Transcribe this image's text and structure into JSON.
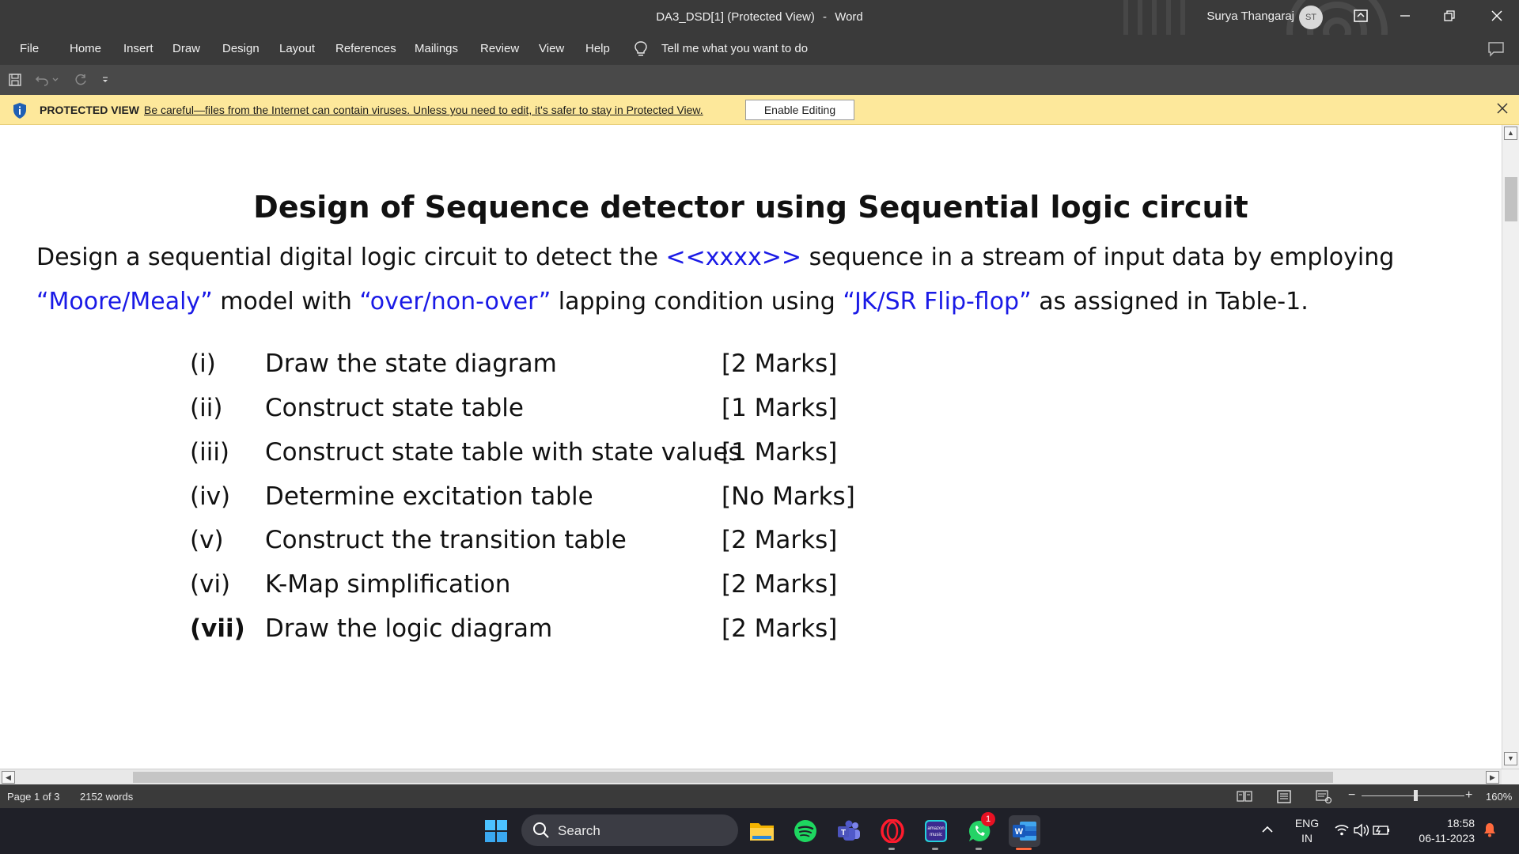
{
  "window": {
    "doc_title": "DA3_DSD[1] (Protected View)",
    "app_name": "Word",
    "title_separator": "-",
    "user_name": "Surya Thangaraj",
    "user_initials": "ST"
  },
  "menu": {
    "tabs": [
      "File",
      "Home",
      "Insert",
      "Draw",
      "Design",
      "Layout",
      "References",
      "Mailings",
      "Review",
      "View",
      "Help"
    ],
    "tell_me": "Tell me what you want to do"
  },
  "protected_view": {
    "label": "PROTECTED VIEW",
    "message": "Be careful—files from the Internet can contain viruses. Unless you need to edit, it's safer to stay in Protected View.",
    "enable_button": "Enable Editing"
  },
  "document": {
    "heading": "Design of Sequence detector using Sequential logic circuit",
    "para": {
      "p1": "Design a sequential digital logic circuit to detect the ",
      "seq": "<<xxxx>>",
      "p2": " sequence in a stream of input data by employing ",
      "model": "“Moore/Mealy”",
      "p3": " model with ",
      "overlap": "“over/non-over”",
      "p4": " lapping condition using ",
      "flipflop": "“JK/SR Flip-flop”",
      "p5": " as assigned in Table-1."
    },
    "tasks": [
      {
        "num": "(i)",
        "desc": "Draw the state diagram",
        "marks": "[2 Marks]"
      },
      {
        "num": "(ii)",
        "desc": "Construct state table",
        "marks": "[1 Marks]"
      },
      {
        "num": "(iii)",
        "desc": "Construct state table with state values",
        "marks": "[1 Marks]"
      },
      {
        "num": "(iv)",
        "desc": "Determine excitation table",
        "marks": "[No Marks]"
      },
      {
        "num": "(v)",
        "desc": "Construct the transition table",
        "marks": "[2 Marks]"
      },
      {
        "num": "(vi)",
        "desc": "K-Map simplification",
        "marks": "[2 Marks]"
      },
      {
        "num": "(vii)",
        "desc": "Draw the logic diagram",
        "marks": "[2 Marks]"
      }
    ]
  },
  "status": {
    "page": "Page 1 of 3",
    "words": "2152 words",
    "zoom": "160%",
    "zoom_minus": "−",
    "zoom_plus": "+"
  },
  "taskbar": {
    "search_label": "Search",
    "whatsapp_badge": "1",
    "amazon_music_text": "amazon music",
    "lang_top": "ENG",
    "lang_bottom": "IN",
    "time": "18:58",
    "date": "06-11-2023"
  },
  "colors": {
    "title_bar": "#3a3a3a",
    "protected_bar": "#fde89b",
    "link_blue": "#1a1ae6",
    "taskbar": "#1f2028",
    "word_blue": "#185abd"
  }
}
